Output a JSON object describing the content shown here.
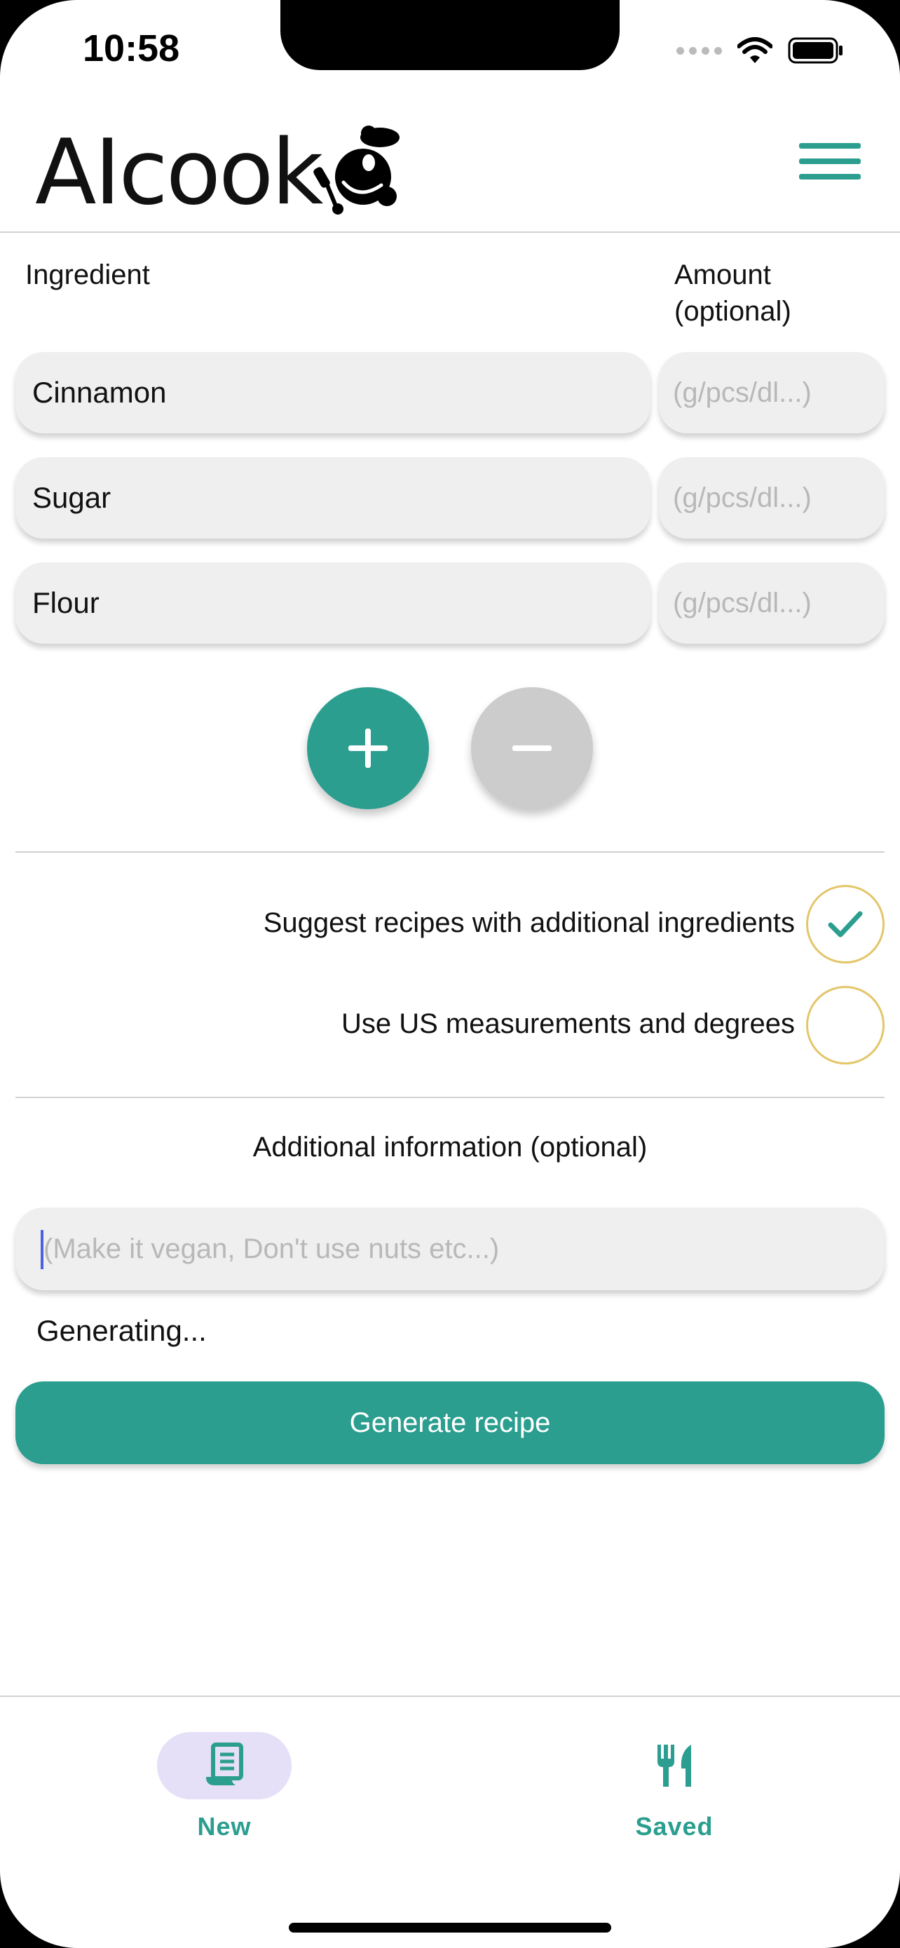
{
  "status_bar": {
    "time": "10:58",
    "icons": [
      "signal-dots-icon",
      "wifi-icon",
      "battery-icon"
    ]
  },
  "header": {
    "logo_text": "AIcook",
    "logo_icon": "chef-mascot-icon",
    "menu_icon": "hamburger-menu-icon"
  },
  "ingredients": {
    "column_ingredient": "Ingredient",
    "column_amount_line1": "Amount",
    "column_amount_line2": "(optional)",
    "rows": [
      {
        "name": "Cinnamon",
        "amount_placeholder": "(g/pcs/dl...)"
      },
      {
        "name": "Sugar",
        "amount_placeholder": "(g/pcs/dl...)"
      },
      {
        "name": "Flour",
        "amount_placeholder": "(g/pcs/dl...)"
      }
    ]
  },
  "options": {
    "additional_ingredients_label": "Suggest recipes with additional ingredients",
    "additional_ingredients_checked": true,
    "us_measurements_label": "Use US measurements and degrees",
    "us_measurements_checked": false
  },
  "additional_info": {
    "label": "Additional information (optional)",
    "placeholder": "(Make it vegan, Don't use nuts etc...)"
  },
  "status_text": "Generating...",
  "generate_button": "Generate recipe",
  "tab_bar": {
    "tabs": [
      {
        "label": "New",
        "icon": "recipe-scroll-icon",
        "active": true
      },
      {
        "label": "Saved",
        "icon": "fork-knife-icon",
        "active": false
      }
    ]
  },
  "colors": {
    "accent": "#2b9e8f",
    "checkbox_border": "#e3c66a",
    "active_tab_pill": "#e5dff7"
  }
}
